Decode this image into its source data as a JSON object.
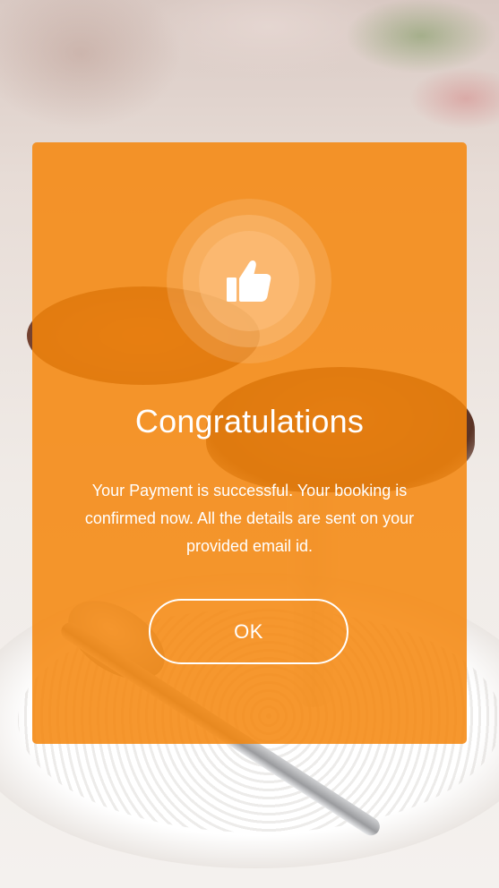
{
  "dialog": {
    "icon": "thumbs-up-icon",
    "title": "Congratulations",
    "message": "Your Payment is successful. Your booking is confirmed now. All the details are sent on your provided email id.",
    "ok_label": "OK"
  },
  "colors": {
    "card_background": "#F5860C",
    "text": "#FFFFFF",
    "button_border": "#FFFFFF"
  }
}
